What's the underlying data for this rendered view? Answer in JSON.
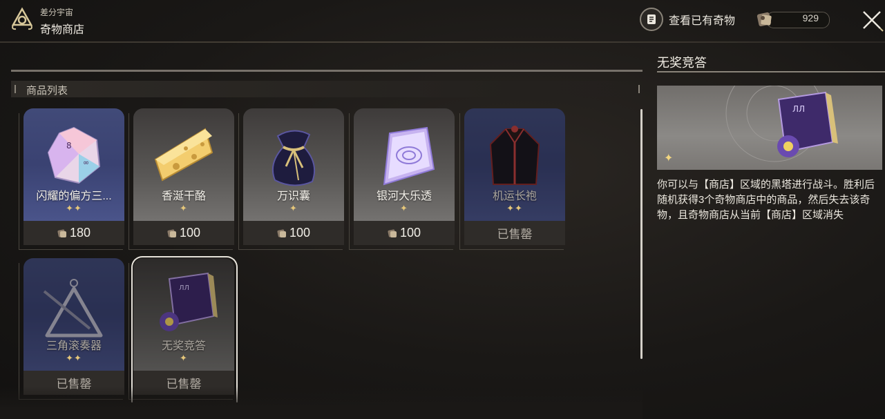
{
  "header": {
    "subtitle": "差分宇宙",
    "title": "奇物商店",
    "view_owned_label": "查看已有奇物",
    "currency_amount": "929"
  },
  "shop": {
    "section_title": "商品列表",
    "items": [
      {
        "name": "闪耀的偏方三...",
        "stars": "✦✦",
        "price": "180",
        "sold": false,
        "bg": "blue",
        "icon": "dice-icon"
      },
      {
        "name": "香涎干酪",
        "stars": "✦",
        "price": "100",
        "sold": false,
        "bg": "gray",
        "icon": "cheese-icon"
      },
      {
        "name": "万识囊",
        "stars": "✦",
        "price": "100",
        "sold": false,
        "bg": "gray",
        "icon": "pouch-icon"
      },
      {
        "name": "银河大乐透",
        "stars": "✦",
        "price": "100",
        "sold": false,
        "bg": "gray",
        "icon": "ticket-icon"
      },
      {
        "name": "机运长袍",
        "stars": "✦✦",
        "price": "已售罄",
        "sold": true,
        "bg": "blue",
        "icon": "robe-icon"
      },
      {
        "name": "三角滚奏器",
        "stars": "✦✦",
        "price": "已售罄",
        "sold": true,
        "bg": "blue",
        "icon": "triangle-icon"
      },
      {
        "name": "无奖竞答",
        "stars": "✦",
        "price": "已售罄",
        "sold": true,
        "bg": "gray",
        "icon": "quiz-book-icon",
        "selected": true
      }
    ]
  },
  "detail": {
    "title": "无奖竞答",
    "stars": "✦",
    "description": "你可以与【商店】区域的黑塔进行战斗。胜利后随机获得3个奇物商店中的商品，然后失去该奇物，且奇物商店从当前【商店】区域消失"
  }
}
